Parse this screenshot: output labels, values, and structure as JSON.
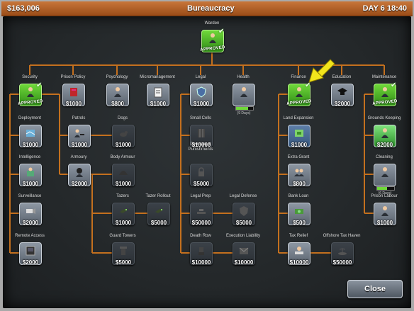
{
  "header": {
    "money": "$163,006",
    "title": "Bureaucracy",
    "time": "DAY 6 18:40"
  },
  "close_label": "Close",
  "colors": {
    "line": "#c4701e",
    "approved": "#4cc22a",
    "arrow": "#f2e51c"
  },
  "nodes": [
    {
      "id": "warden",
      "label": "Warden",
      "status": "APPROVED",
      "icon": "warden-icon",
      "style": "approved"
    },
    {
      "id": "security",
      "label": "Security",
      "status": "APPROVED",
      "icon": "guard-icon",
      "style": "approved"
    },
    {
      "id": "prison-policy",
      "label": "Prison Policy",
      "price": "$1000",
      "icon": "book-icon",
      "style": "normal"
    },
    {
      "id": "psychology",
      "label": "Psychology",
      "price": "$800",
      "icon": "psychologist-icon",
      "style": "normal"
    },
    {
      "id": "micromanagement",
      "label": "Micromanagement",
      "price": "$1000",
      "icon": "clipboard-icon",
      "style": "normal"
    },
    {
      "id": "legal",
      "label": "Legal",
      "price": "$1000",
      "icon": "badge-icon",
      "style": "normal"
    },
    {
      "id": "health",
      "label": "Health",
      "progress_text": "(9 Days)",
      "progress": 0.7,
      "icon": "doctor-icon",
      "style": "normal"
    },
    {
      "id": "finance",
      "label": "Finance",
      "status": "APPROVED",
      "icon": "accountant-icon",
      "style": "approved"
    },
    {
      "id": "education",
      "label": "Education",
      "price": "$2000",
      "icon": "graduation-cap-icon",
      "style": "normal"
    },
    {
      "id": "maintenance",
      "label": "Maintenance",
      "status": "APPROVED",
      "icon": "workman-icon",
      "style": "approved"
    },
    {
      "id": "deployment",
      "label": "Deployment",
      "price": "$1000",
      "icon": "map-icon",
      "style": "normal"
    },
    {
      "id": "patrols",
      "label": "Patrols",
      "price": "$1000",
      "icon": "patrol-icon",
      "style": "normal"
    },
    {
      "id": "dogs",
      "label": "Dogs",
      "price": "$1000",
      "icon": "dog-icon",
      "style": "dim"
    },
    {
      "id": "intelligence",
      "label": "Intelligence",
      "price": "$1000",
      "icon": "intel-icon",
      "style": "normal"
    },
    {
      "id": "armoury",
      "label": "Armoury",
      "price": "$2000",
      "icon": "armoury-icon",
      "style": "normal"
    },
    {
      "id": "body-armour",
      "label": "Body Armour",
      "price": "$1000",
      "icon": "helmet-icon",
      "style": "dim"
    },
    {
      "id": "surveillance",
      "label": "Surveillance",
      "price": "$2000",
      "icon": "camera-icon",
      "style": "normal"
    },
    {
      "id": "tazers",
      "label": "Tazers",
      "price": "$1000",
      "icon": "taser-icon",
      "style": "dim"
    },
    {
      "id": "tazer-rollout",
      "label": "Tazer Rollout",
      "price": "$5000",
      "icon": "taser-icon",
      "style": "dim"
    },
    {
      "id": "remote-access",
      "label": "Remote Access",
      "price": "$2000",
      "icon": "console-icon",
      "style": "normal"
    },
    {
      "id": "guard-towers",
      "label": "Guard Towers",
      "price": "$5000",
      "icon": "tower-icon",
      "style": "dim"
    },
    {
      "id": "small-cells",
      "label": "Small Cells",
      "price": "$10000",
      "icon": "cell-icon",
      "style": "dim"
    },
    {
      "id": "permanent-punishments",
      "label": "Permanent Punishments",
      "price": "$5000",
      "icon": "lock-icon",
      "style": "dim"
    },
    {
      "id": "legal-prep",
      "label": "Legal Prep",
      "price": "$50000",
      "icon": "gavel-icon",
      "style": "dim"
    },
    {
      "id": "legal-defense",
      "label": "Legal Defense",
      "price": "$5000",
      "icon": "shield-icon",
      "style": "dim"
    },
    {
      "id": "death-row",
      "label": "Death Row",
      "price": "$10000",
      "icon": "chair-icon",
      "style": "dim"
    },
    {
      "id": "execution-liability",
      "label": "Execution Liability",
      "price": "$10000",
      "icon": "envelope-icon",
      "style": "dim"
    },
    {
      "id": "land-expansion",
      "label": "Land Expansion",
      "price": "$1000",
      "icon": "land-icon",
      "style": "blue"
    },
    {
      "id": "extra-grant",
      "label": "Extra Grant",
      "price": "$800",
      "icon": "people-icon",
      "style": "normal"
    },
    {
      "id": "bank-loan",
      "label": "Bank Loan",
      "price": "$500",
      "icon": "money-icon",
      "style": "normal"
    },
    {
      "id": "tax-relief",
      "label": "Tax Relief",
      "price": "$10000",
      "icon": "desk-icon",
      "style": "normal"
    },
    {
      "id": "offshore-tax-haven",
      "label": "Offshore Tax Haven",
      "price": "$50000",
      "icon": "island-icon",
      "style": "dim"
    },
    {
      "id": "grounds-keeping",
      "label": "Grounds Keeping",
      "price": "$2000",
      "icon": "gardener-icon",
      "style": "green"
    },
    {
      "id": "cleaning",
      "label": "Cleaning",
      "progress_text": "(6 Days)",
      "progress": 0.6,
      "icon": "cleaner-icon",
      "style": "normal"
    },
    {
      "id": "prison-labour",
      "label": "Prison Labour",
      "price": "$1000",
      "icon": "labour-icon",
      "style": "normal"
    }
  ]
}
